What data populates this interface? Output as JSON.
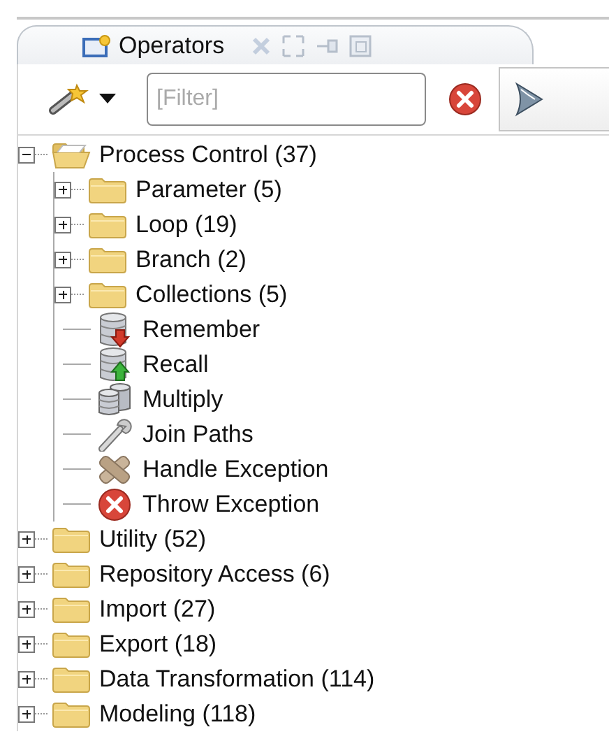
{
  "tab": {
    "title": "Operators"
  },
  "filter": {
    "placeholder": "[Filter]"
  },
  "tree": [
    {
      "kind": "folder",
      "label": "Process Control (37)",
      "expanded": true,
      "children": [
        {
          "kind": "folder",
          "label": "Parameter (5)",
          "expanded": false
        },
        {
          "kind": "folder",
          "label": "Loop (19)",
          "expanded": false
        },
        {
          "kind": "folder",
          "label": "Branch (2)",
          "expanded": false
        },
        {
          "kind": "folder",
          "label": "Collections (5)",
          "expanded": false
        },
        {
          "kind": "store",
          "label": "Remember"
        },
        {
          "kind": "retrieve",
          "label": "Recall"
        },
        {
          "kind": "multiply",
          "label": "Multiply"
        },
        {
          "kind": "join",
          "label": "Join Paths"
        },
        {
          "kind": "handle",
          "label": "Handle Exception"
        },
        {
          "kind": "throw",
          "label": "Throw Exception"
        }
      ]
    },
    {
      "kind": "folder",
      "label": "Utility (52)",
      "expanded": false
    },
    {
      "kind": "folder",
      "label": "Repository Access (6)",
      "expanded": false
    },
    {
      "kind": "folder",
      "label": "Import (27)",
      "expanded": false
    },
    {
      "kind": "folder",
      "label": "Export (18)",
      "expanded": false
    },
    {
      "kind": "folder",
      "label": "Data Transformation (114)",
      "expanded": false
    },
    {
      "kind": "folder",
      "label": "Modeling (118)",
      "expanded": false
    }
  ]
}
